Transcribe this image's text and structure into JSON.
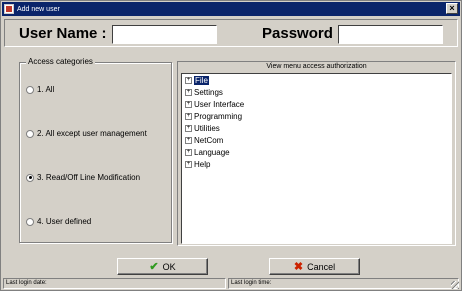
{
  "window": {
    "title": "Add new user"
  },
  "login": {
    "username_label": "User Name :",
    "username_value": "",
    "password_label": "Password :",
    "password_value": ""
  },
  "access": {
    "legend": "Access categories",
    "options": [
      {
        "label": "1. All",
        "checked": false
      },
      {
        "label": "2. All except user management",
        "checked": false
      },
      {
        "label": "3. Read/Off Line Modification",
        "checked": true
      },
      {
        "label": "4. User defined",
        "checked": false
      }
    ]
  },
  "menu_access": {
    "header": "View menu access authorization",
    "items": [
      {
        "label": "File",
        "selected": true
      },
      {
        "label": "Settings",
        "selected": false
      },
      {
        "label": "User Interface",
        "selected": false
      },
      {
        "label": "Programming",
        "selected": false
      },
      {
        "label": "Utilities",
        "selected": false
      },
      {
        "label": "NetCom",
        "selected": false
      },
      {
        "label": "Language",
        "selected": false
      },
      {
        "label": "Help",
        "selected": false
      }
    ],
    "expander_glyph": "+"
  },
  "buttons": {
    "ok_label": "OK",
    "cancel_label": "Cancel"
  },
  "status": {
    "last_login_date": "Last login date:",
    "last_login_time": "Last login time:"
  },
  "icons": {
    "ok": "checkmark-icon",
    "cancel": "x-icon",
    "close": "close-icon",
    "app": "user-app-icon"
  },
  "colors": {
    "titlebar": "#0a246a",
    "ok_icon": "#2f9a1f",
    "cancel_icon": "#cc2200",
    "selection": "#0a246a"
  }
}
